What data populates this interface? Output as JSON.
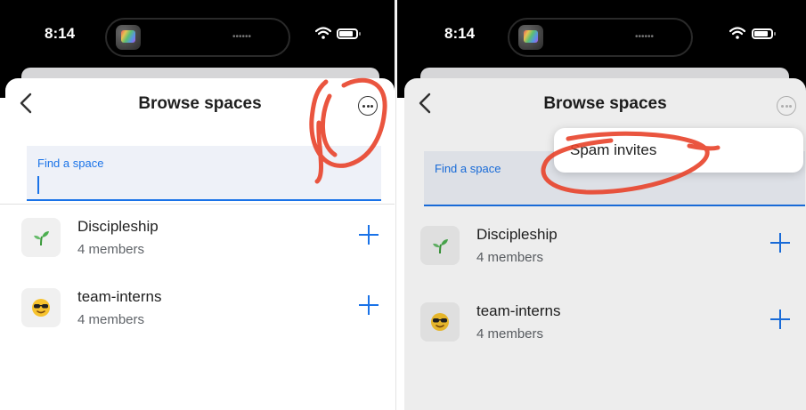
{
  "left": {
    "status_time": "8:14",
    "title": "Browse spaces",
    "search_placeholder": "Find a space",
    "spaces": [
      {
        "name": "Discipleship",
        "members": "4 members",
        "icon": "seedling-icon"
      },
      {
        "name": "team-interns",
        "members": "4 members",
        "icon": "sunglasses-face-icon"
      }
    ]
  },
  "right": {
    "status_time": "8:14",
    "title": "Browse spaces",
    "search_placeholder": "Find a space",
    "menu_item": "Spam invites",
    "spaces": [
      {
        "name": "Discipleship",
        "members": "4 members",
        "icon": "seedling-icon"
      },
      {
        "name": "team-interns",
        "members": "4 members",
        "icon": "sunglasses-face-icon"
      }
    ]
  },
  "colors": {
    "accent": "#1a73e8",
    "annotation": "#e8432a"
  }
}
